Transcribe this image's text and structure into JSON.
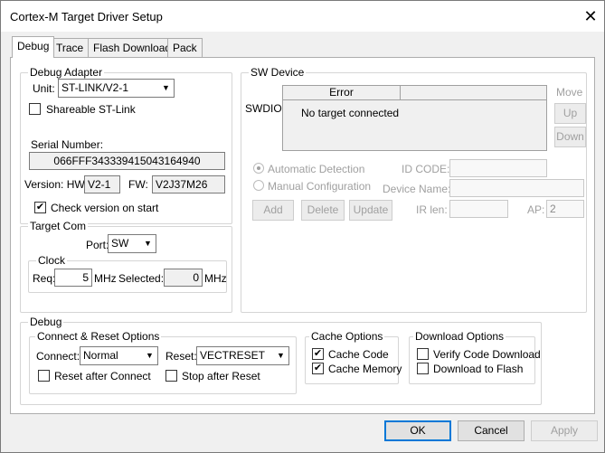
{
  "window": {
    "title": "Cortex-M Target Driver Setup",
    "close_glyph": "✕"
  },
  "tabs": [
    "Debug",
    "Trace",
    "Flash Download",
    "Pack"
  ],
  "debug_adapter": {
    "group_label": "Debug Adapter",
    "unit_label": "Unit:",
    "unit_value": "ST-LINK/V2-1",
    "shareable_label": "Shareable ST-Link",
    "shareable_checked": false,
    "serial_label": "Serial Number:",
    "serial_value": "066FFF343339415043164940",
    "version_label": "Version: HW:",
    "hw_value": "V2-1",
    "fw_label": "FW:",
    "fw_value": "V2J37M26",
    "check_version_label": "Check version on start",
    "check_version_checked": true
  },
  "target_com": {
    "group_label": "Target Com",
    "port_label": "Port:",
    "port_value": "SW",
    "clock_label": "Clock",
    "req_label": "Req:",
    "req_value": "5",
    "req_unit": "MHz",
    "selected_label": "Selected:",
    "selected_value": "0",
    "selected_unit": "MHz"
  },
  "sw_device": {
    "group_label": "SW Device",
    "swdio_label": "SWDIO",
    "col_error": "Error",
    "status": "No target connected",
    "move_label": "Move",
    "up_label": "Up",
    "down_label": "Down",
    "auto_detect_label": "Automatic Detection",
    "manual_config_label": "Manual Configuration",
    "id_code_label": "ID CODE:",
    "device_name_label": "Device Name:",
    "ir_len_label": "IR len:",
    "ap_label": "AP:",
    "ap_value": "2",
    "add_label": "Add",
    "delete_label": "Delete",
    "update_label": "Update"
  },
  "debug_group": {
    "group_label": "Debug",
    "connect_reset_label": "Connect & Reset Options",
    "connect_label": "Connect:",
    "connect_value": "Normal",
    "reset_label": "Reset:",
    "reset_value": "VECTRESET",
    "reset_after_connect_label": "Reset after Connect",
    "stop_after_reset_label": "Stop after Reset",
    "cache_options_label": "Cache Options",
    "cache_code_label": "Cache Code",
    "cache_memory_label": "Cache Memory",
    "download_options_label": "Download Options",
    "verify_label": "Verify Code Download",
    "download_flash_label": "Download to Flash"
  },
  "footer": {
    "ok_label": "OK",
    "cancel_label": "Cancel",
    "apply_label": "Apply"
  },
  "check_glyph": "✔",
  "arrow_glyph": "▼"
}
